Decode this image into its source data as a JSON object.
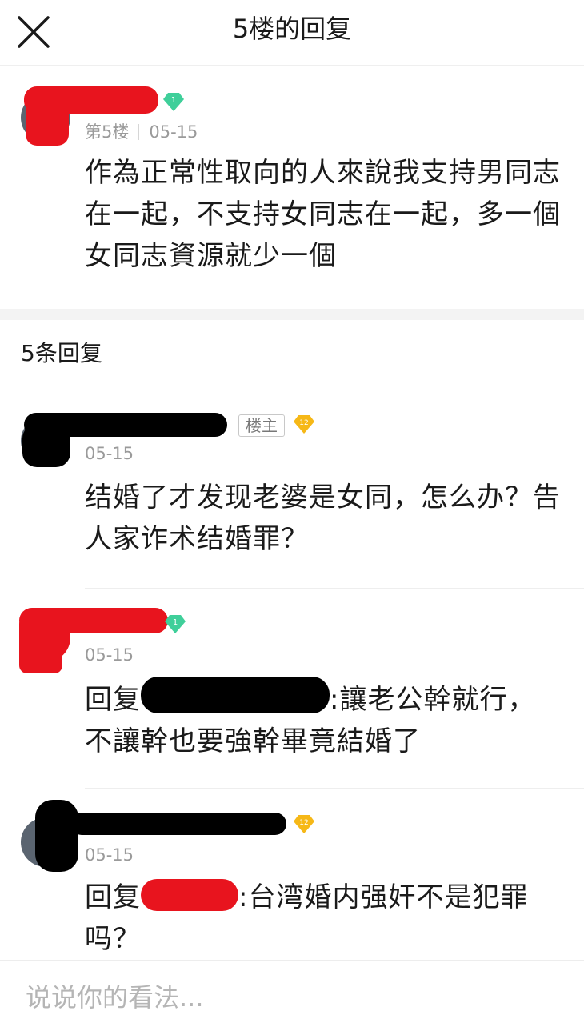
{
  "header": {
    "title": "5楼的回复",
    "close_icon": "close-icon"
  },
  "post": {
    "floor": "第5楼",
    "date": "05-15",
    "level": "1",
    "text": "作為正常性取向的人來說我支持男同志在一起，不支持女同志在一起，多一個女同志資源就少一個"
  },
  "replies_header": "5条回复",
  "replies": [
    {
      "date": "05-15",
      "op_tag": "楼主",
      "level": "12",
      "text": "结婚了才发现老婆是女同，怎么办？告人家诈术结婚罪？"
    },
    {
      "date": "05-15",
      "level": "1",
      "reply_prefix": "回复",
      "text_after": ":讓老公幹就行，",
      "text_line2": "不讓幹也要強幹畢竟結婚了"
    },
    {
      "date": "05-15",
      "level": "12",
      "reply_prefix": "回复",
      "text_after": ":台湾婚内强奸不是犯罪",
      "text_line2": "吗？"
    }
  ],
  "footer": {
    "placeholder": "说说你的看法..."
  },
  "colors": {
    "redact_red": "#e8141e",
    "redact_black": "#000000",
    "badge_green": "#3fcf9a",
    "badge_gold": "#f6b817"
  }
}
